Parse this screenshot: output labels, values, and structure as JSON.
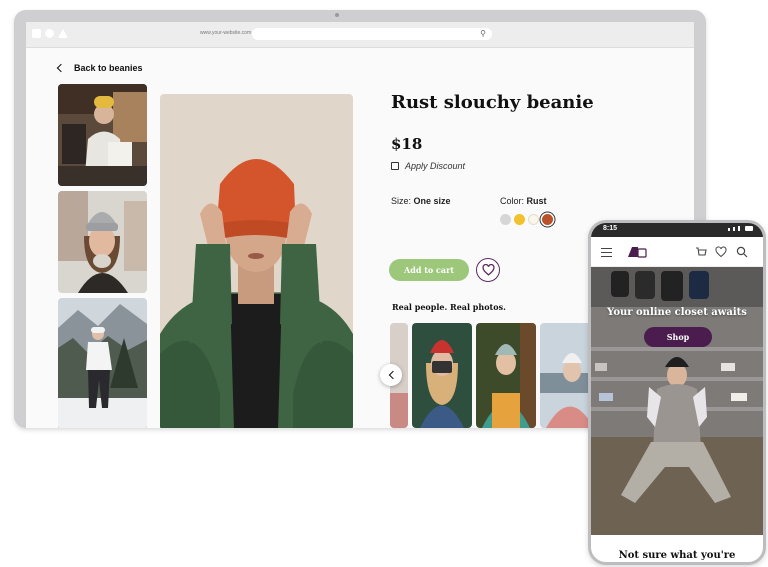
{
  "browser": {
    "url": "www.your-website.com"
  },
  "page": {
    "back_label": "Back to beanies",
    "product_title": "Rust slouchy beanie",
    "price": "$18",
    "discount_label": "Apply Discount",
    "size_label": "Size:",
    "size_value": "One size",
    "color_label": "Color:",
    "color_value": "Rust",
    "swatches": [
      "#d6d6d6",
      "#f2c12e",
      "#fbf6e6",
      "#b9512a"
    ],
    "add_to_cart_label": "Add to cart",
    "real_people_title": "Real people. Real photos."
  },
  "phone": {
    "time": "8:15",
    "hero_heading": "Your online closet awaits",
    "shop_label": "Shop",
    "bottom_heading": "Not sure what you're"
  },
  "colors": {
    "accent_green": "#9dc77a",
    "brand_purple": "#4b1c4e"
  }
}
